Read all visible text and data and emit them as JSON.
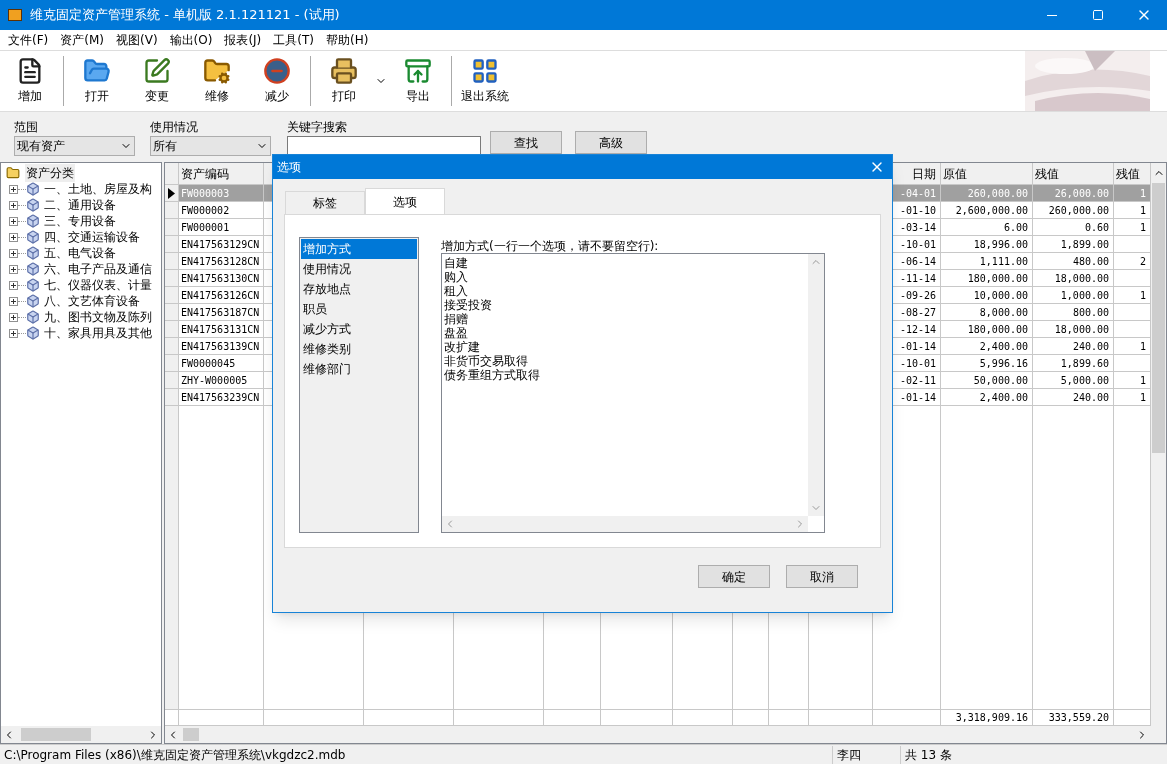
{
  "window": {
    "title": "维克固定资产管理系统 - 单机版 2.1.121121 - (试用)"
  },
  "menu": [
    "文件(F)",
    "资产(M)",
    "视图(V)",
    "输出(O)",
    "报表(J)",
    "工具(T)",
    "帮助(H)"
  ],
  "toolbar": [
    [
      {
        "label": "增加",
        "kind": "add"
      }
    ],
    [
      {
        "label": "打开",
        "kind": "open"
      },
      {
        "label": "变更",
        "kind": "change"
      },
      {
        "label": "维修",
        "kind": "repair"
      },
      {
        "label": "减少",
        "kind": "reduce"
      }
    ],
    [
      {
        "label": "打印",
        "kind": "print"
      },
      {
        "label": "导出",
        "kind": "export"
      }
    ],
    [
      {
        "label": "退出系统",
        "kind": "exit"
      }
    ]
  ],
  "filters": {
    "scope": {
      "label": "范围",
      "value": "现有资产"
    },
    "usage": {
      "label": "使用情况",
      "value": "所有"
    },
    "keyword": {
      "label": "关键字搜索"
    },
    "buttons": [
      "查找",
      "高级"
    ]
  },
  "tree": {
    "label": "资产分类",
    "expanded": true,
    "children": [
      {
        "label": "一、土地、房屋及构",
        "expanded": false
      },
      {
        "label": "二、通用设备",
        "expanded": false
      },
      {
        "label": "三、专用设备",
        "expanded": false
      },
      {
        "label": "四、交通运输设备",
        "expanded": false
      },
      {
        "label": "五、电气设备",
        "expanded": false
      },
      {
        "label": "六、电子产品及通信",
        "expanded": false
      },
      {
        "label": "七、仪器仪表、计量",
        "expanded": false
      },
      {
        "label": "八、文艺体育设备",
        "expanded": false
      },
      {
        "label": "九、图书文物及陈列",
        "expanded": false
      },
      {
        "label": "十、家具用具及其他",
        "expanded": false
      }
    ]
  },
  "table": {
    "columns": [
      "资产编码",
      "日期",
      "原值",
      "残值",
      "残值"
    ],
    "rows": [
      {
        "selected": true,
        "code": "FW000003",
        "date": "-04-01",
        "original": "260,000.00",
        "residual": "26,000.00",
        "rate": "1"
      },
      {
        "selected": false,
        "code": "FW000002",
        "date": "-01-10",
        "original": "2,600,000.00",
        "residual": "260,000.00",
        "rate": "1"
      },
      {
        "selected": false,
        "code": "FW000001",
        "date": "-03-14",
        "original": "6.00",
        "residual": "0.60",
        "rate": "1"
      },
      {
        "selected": false,
        "code": "EN417563129CN",
        "date": "-10-01",
        "original": "18,996.00",
        "residual": "1,899.00"
      },
      {
        "selected": false,
        "code": "EN417563128CN",
        "date": "-06-14",
        "original": "1,111.00",
        "residual": "480.00",
        "rate": "2"
      },
      {
        "selected": false,
        "code": "EN417563130CN",
        "date": "-11-14",
        "original": "180,000.00",
        "residual": "18,000.00"
      },
      {
        "selected": false,
        "code": "EN417563126CN",
        "date": "-09-26",
        "original": "10,000.00",
        "residual": "1,000.00",
        "rate": "1"
      },
      {
        "selected": false,
        "code": "EN417563187CN",
        "date": "-08-27",
        "original": "8,000.00",
        "residual": "800.00"
      },
      {
        "selected": false,
        "code": "EN417563131CN",
        "date": "-12-14",
        "original": "180,000.00",
        "residual": "18,000.00"
      },
      {
        "selected": false,
        "code": "EN417563139CN",
        "date": "-01-14",
        "original": "2,400.00",
        "residual": "240.00",
        "rate": "1"
      },
      {
        "selected": false,
        "code": "FW0000045",
        "date": "-10-01",
        "original": "5,996.16",
        "residual": "1,899.60"
      },
      {
        "selected": false,
        "code": "ZHY-W000005",
        "date": "-02-11",
        "original": "50,000.00",
        "residual": "5,000.00",
        "rate": "1"
      },
      {
        "selected": false,
        "code": "EN417563239CN",
        "date": "-01-14",
        "original": "2,400.00",
        "residual": "240.00",
        "rate": "1"
      }
    ],
    "totals": [
      "3,318,909.16",
      "333,559.20"
    ]
  },
  "dialog": {
    "title": "选项",
    "tabs": [
      {
        "label": "标签",
        "selected": false
      },
      {
        "label": "选项",
        "selected": true
      }
    ],
    "categories": [
      {
        "label": "增加方式",
        "selected": true
      },
      {
        "label": "使用情况",
        "selected": false
      },
      {
        "label": "存放地点",
        "selected": false
      },
      {
        "label": "职员",
        "selected": false
      },
      {
        "label": "减少方式",
        "selected": false
      },
      {
        "label": "维修类别",
        "selected": false
      },
      {
        "label": "维修部门",
        "selected": false
      }
    ],
    "editor_label": "增加方式(一行一个选项，请不要留空行):",
    "editor_lines": [
      "自建",
      "购入",
      "租入",
      "接受投资",
      "捐赠",
      "盘盈",
      "改扩建",
      "非货币交易取得",
      "债务重组方式取得"
    ],
    "buttons": [
      "确定",
      "取消"
    ]
  },
  "status_bar": [
    "C:\\Program Files (x86)\\维克固定资产管理系统\\vkgdzc2.mdb",
    "李四",
    "共 13 条"
  ]
}
